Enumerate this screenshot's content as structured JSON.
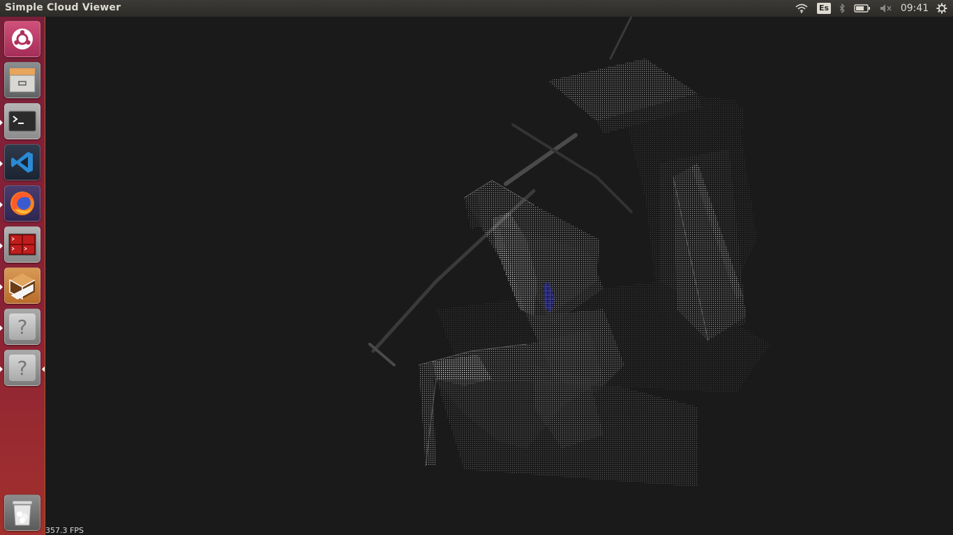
{
  "window": {
    "title": "Simple Cloud Viewer"
  },
  "panel": {
    "keyboard_layout": "Es",
    "clock": "09:41",
    "indicators": [
      "wifi-icon",
      "keyboard-layout-indicator",
      "bluetooth-icon",
      "battery-icon",
      "volume-muted-icon",
      "session-gear-icon"
    ]
  },
  "launcher": {
    "items": [
      {
        "id": "ubuntu-dash",
        "icon": "ubuntu-logo-icon",
        "running": false
      },
      {
        "id": "files",
        "icon": "file-cabinet-icon",
        "running": false
      },
      {
        "id": "terminal",
        "icon": "terminal-icon",
        "running": true
      },
      {
        "id": "vscode",
        "icon": "vscode-icon",
        "running": true
      },
      {
        "id": "firefox",
        "icon": "firefox-icon",
        "running": true
      },
      {
        "id": "terminator",
        "icon": "terminator-icon",
        "running": true
      },
      {
        "id": "box-app",
        "icon": "isometric-box-icon",
        "running": true
      },
      {
        "id": "unknown-app-1",
        "icon": "question-mark-icon",
        "running": true
      },
      {
        "id": "unknown-app-2",
        "icon": "question-mark-icon",
        "running": true,
        "focused": true
      },
      {
        "id": "trash",
        "icon": "trash-icon",
        "running": false
      }
    ]
  },
  "viewer": {
    "fps": "357.3 FPS",
    "background": "#1a1a1a",
    "highlight_color": "#2a2ad0"
  }
}
